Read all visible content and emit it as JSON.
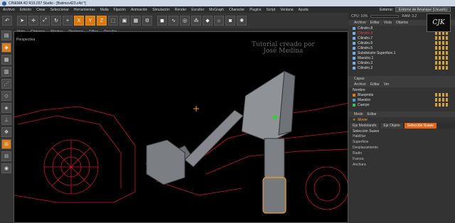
{
  "window": {
    "title": "CINEMA 4D R15.037 Studio - [Batimovil23.c4d *]"
  },
  "menu": [
    "Archivo",
    "Edición",
    "Crear",
    "Seleccionar",
    "Herramientas",
    "Malla",
    "Fijación",
    "Animación",
    "Simulación",
    "Render",
    "Escultor",
    "MoGraph",
    "Character",
    "Plugins",
    "Script",
    "Ventana",
    "Ayuda"
  ],
  "layout": {
    "label": "Entorno:",
    "value": "Entorno de Arranque (Usuario)"
  },
  "toolbar": {
    "axes": [
      "X",
      "Y",
      "Z"
    ]
  },
  "viewport": {
    "menu": [
      "Vista",
      "Cámaras",
      "Mostrar",
      "Opciones",
      "Filtrar",
      "Paneles"
    ],
    "label": "Perspectiva",
    "watermark_line1": "Tutorial creado por",
    "watermark_line2": "José Medina"
  },
  "right": {
    "cpu": "CPU: 10%",
    "ram": "RAM: 3.2",
    "obj_menu": [
      "Archivo",
      "Editar",
      "Vista",
      "Objetos"
    ],
    "objects": [
      "Cilindro.8",
      "Cilindro.8",
      "Cilindro.7",
      "Cilindro.6",
      "Cilindro.5",
      "Subdivisión Superficie.1",
      "Maestro.1",
      "Cilindro.3",
      "Cilindro.2"
    ],
    "layers_title": "Capas",
    "layers_menu": [
      "Archivo",
      "Editar",
      "Ver"
    ],
    "layers_header": "Nombre",
    "layers": [
      "Blueprints",
      "Maestro",
      "Cuerpo"
    ],
    "attr_menu": [
      "Modo",
      "Editar"
    ],
    "attr_title": "Mover",
    "attr_tabs": [
      "Eje Modelando",
      "Eje Objeto",
      "Selección Suave"
    ],
    "attr_section": "Selección Suave",
    "attr_fields": [
      "Habilitar",
      "Superficie",
      "Desplazamiento",
      "Radio",
      "Fuerza",
      "Anchura"
    ]
  },
  "corner_logo": "CJK"
}
